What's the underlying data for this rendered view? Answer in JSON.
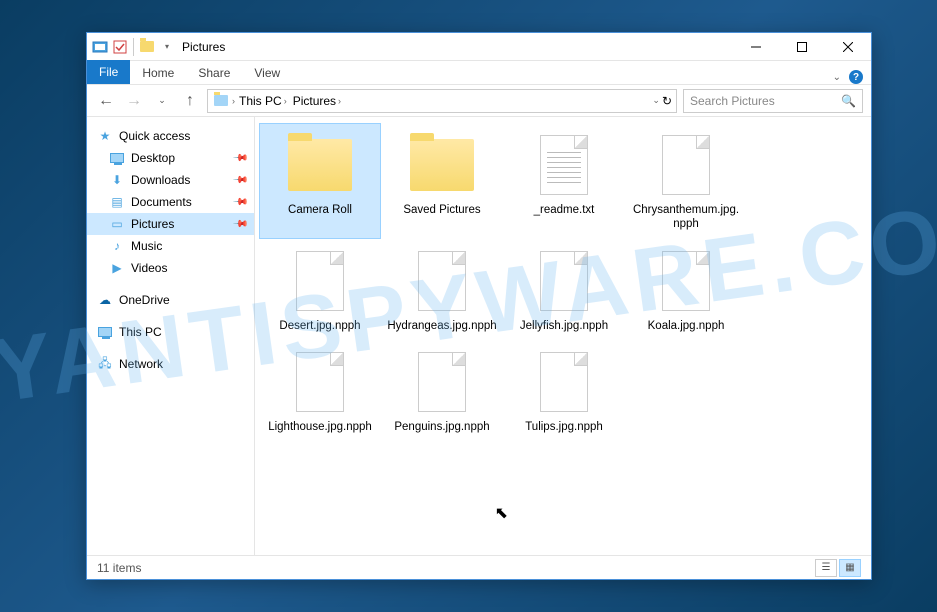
{
  "watermark": "MYANTISPYWARE.COM",
  "titlebar": {
    "title": "Pictures"
  },
  "ribbon": {
    "file": "File",
    "tabs": [
      "Home",
      "Share",
      "View"
    ]
  },
  "address": {
    "segments": [
      "This PC",
      "Pictures"
    ]
  },
  "search": {
    "placeholder": "Search Pictures"
  },
  "nav": {
    "quick_access": "Quick access",
    "pinned": [
      {
        "label": "Desktop"
      },
      {
        "label": "Downloads"
      },
      {
        "label": "Documents"
      },
      {
        "label": "Pictures"
      },
      {
        "label": "Music"
      },
      {
        "label": "Videos"
      }
    ],
    "onedrive": "OneDrive",
    "thispc": "This PC",
    "network": "Network"
  },
  "items": [
    {
      "label": "Camera Roll",
      "type": "folder",
      "selected": true
    },
    {
      "label": "Saved Pictures",
      "type": "folder"
    },
    {
      "label": "_readme.txt",
      "type": "text"
    },
    {
      "label": "Chrysanthemum.jpg.npph",
      "type": "file"
    },
    {
      "label": "Desert.jpg.npph",
      "type": "file"
    },
    {
      "label": "Hydrangeas.jpg.npph",
      "type": "file"
    },
    {
      "label": "Jellyfish.jpg.npph",
      "type": "file"
    },
    {
      "label": "Koala.jpg.npph",
      "type": "file"
    },
    {
      "label": "Lighthouse.jpg.npph",
      "type": "file"
    },
    {
      "label": "Penguins.jpg.npph",
      "type": "file"
    },
    {
      "label": "Tulips.jpg.npph",
      "type": "file"
    }
  ],
  "status": {
    "count": "11 items"
  }
}
